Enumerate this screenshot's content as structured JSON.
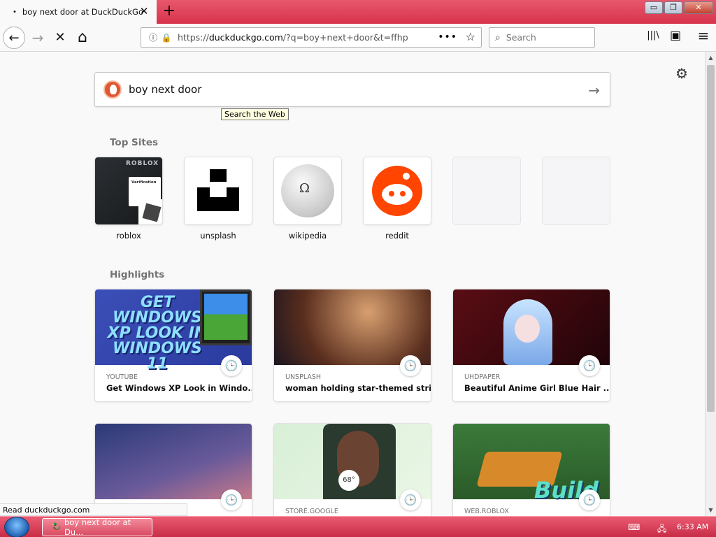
{
  "tab": {
    "title": "boy next door at DuckDuckGo",
    "dot": "•",
    "close": "✕"
  },
  "new_tab": "+",
  "window_controls": {
    "minimize": "▭",
    "restore": "❐",
    "close": "✕"
  },
  "nav": {
    "back": "←",
    "forward": "→",
    "stop": "✕",
    "home": "⌂"
  },
  "url": {
    "prefix": "https://",
    "host": "duckduckgo.com",
    "path": "/?q=boy+next+door&t=ffhp",
    "more": "•••",
    "bookmark": "☆"
  },
  "search": {
    "placeholder": "Search",
    "icon": "⌕"
  },
  "toolbar_right": {
    "library": "|||\\",
    "sidebar": "▣",
    "menu": "≡"
  },
  "page": {
    "settings_icon": "⚙",
    "query": "boy next door",
    "submit_arrow": "→",
    "tooltip": "Search the Web",
    "top_sites_title": "Top Sites",
    "highlights_title": "Highlights"
  },
  "roblox_tile": {
    "wordmark": "ROBLOX",
    "card_label": "Verification"
  },
  "wiki_glyph": "Ω",
  "top_sites": [
    {
      "label": "roblox"
    },
    {
      "label": "unsplash"
    },
    {
      "label": "wikipedia"
    },
    {
      "label": "reddit"
    },
    {
      "label": ""
    },
    {
      "label": ""
    }
  ],
  "highlights": [
    {
      "source": "YOUTUBE",
      "title": "Get Windows XP Look in Windo...",
      "thumb_text": "GET WINDOWS XP LOOK IN WINDOWS 11"
    },
    {
      "source": "UNSPLASH",
      "title": "woman holding star-themed stri..."
    },
    {
      "source": "UHDPAPER",
      "title": "Beautiful Anime Girl Blue Hair ..."
    },
    {
      "source": "",
      "title": ""
    },
    {
      "source": "STORE.GOOGLE",
      "title": "",
      "thumb_text": "68°"
    },
    {
      "source": "WEB.ROBLOX",
      "title": "",
      "thumb_text": "Build"
    }
  ],
  "clock_icon": "🕒",
  "status_text": "Read duckduckgo.com",
  "taskbar": {
    "item_label": "boy next door at Du...",
    "item_icon": "🦆",
    "time": "6:33 AM",
    "tray_keyboard": "⌨",
    "tray_network": "🖧"
  },
  "scroll": {
    "up": "▲",
    "down": "▼"
  }
}
